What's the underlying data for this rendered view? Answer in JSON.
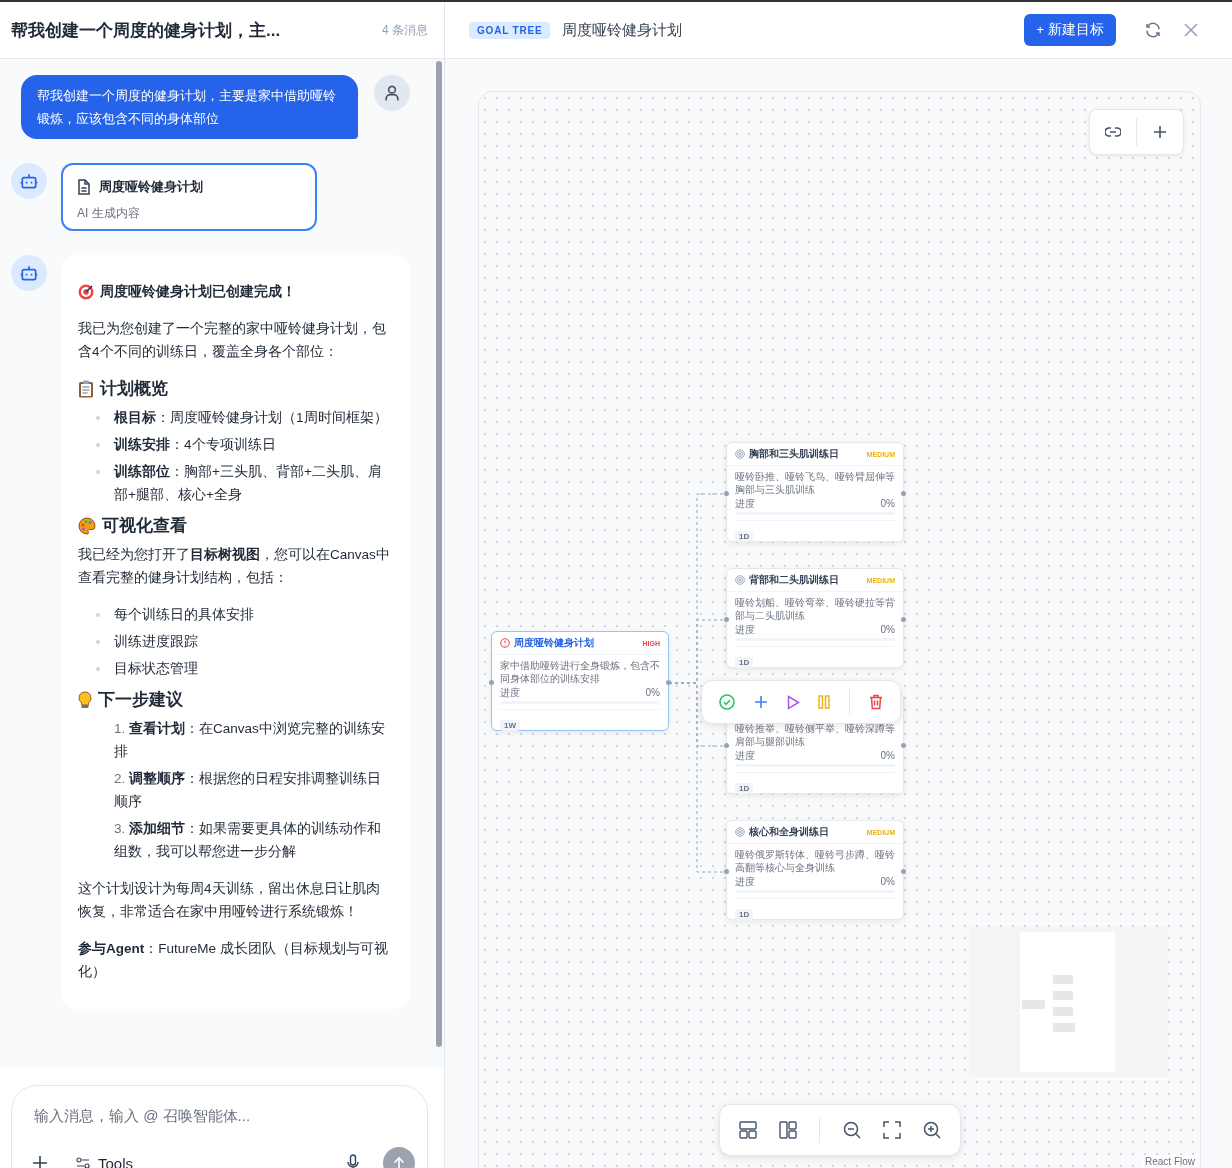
{
  "chat": {
    "title": "帮我创建一个周度的健身计划，主...",
    "count": "4 条消息",
    "user_message": "帮我创建一个周度的健身计划，主要是家中借助哑铃锻炼，应该包含不同的身体部位",
    "artifact": {
      "title": "周度哑铃健身计划",
      "subtitle": "AI 生成内容"
    },
    "reply": [
      {
        "kind": "title",
        "text": "周度哑铃健身计划已创建完成！"
      },
      {
        "kind": "paragraph",
        "text": "我已为您创建了一个完整的家中哑铃健身计划，包含4个不同的训练日，覆盖全身各个部位："
      },
      {
        "kind": "heading",
        "text": "计划概览"
      },
      {
        "kind": "bullets",
        "items": [
          "**根目标**：周度哑铃健身计划（1周时间框架）",
          "**训练安排**：4个专项训练日",
          "**训练部位**：胸部+三头肌、背部+二头肌、肩部+腿部、核心+全身"
        ]
      },
      {
        "kind": "heading",
        "text": "可视化查看"
      },
      {
        "kind": "paragraph",
        "text": "我已经为您打开了**目标树视图**，您可以在Canvas中查看完整的健身计划结构，包括："
      },
      {
        "kind": "bullets",
        "items": [
          "每个训练日的具体安排",
          "训练进度跟踪",
          "目标状态管理"
        ]
      },
      {
        "kind": "heading",
        "text": "下一步建议"
      },
      {
        "kind": "numbered",
        "items": [
          {
            "number": "1.",
            "text": "**查看计划**：在Canvas中浏览完整的训练安排"
          },
          {
            "number": "2.",
            "text": "**调整顺序**：根据您的日程安排调整训练日顺序"
          },
          {
            "number": "3.",
            "text": "**添加细节**：如果需要更具体的训练动作和组数，我可以帮您进一步分解"
          }
        ]
      },
      {
        "kind": "paragraph",
        "text": "这个计划设计为每周4天训练，留出休息日让肌肉恢复，非常适合在家中用哑铃进行系统锻炼！"
      },
      {
        "kind": "paragraph",
        "text": "**参与Agent**：FutureMe 成长团队（目标规划与可视化）"
      }
    ],
    "input": {
      "placeholder": "输入消息，输入 @ 召唤智能体...",
      "tools_label": "Tools",
      "send_disabled": true
    }
  },
  "canvas": {
    "badge": "GOAL TREE",
    "title": "周度哑铃健身计划",
    "new_button": "+ 新建目标",
    "root": {
      "title": "周度哑铃健身计划",
      "priority": "HIGH",
      "description": "家中借助哑铃进行全身锻炼，包含不同身体部位的训练安排",
      "progress_label": "进度",
      "progress": "0%",
      "level": 0,
      "duration": "1W",
      "selected": true,
      "children": [
        {
          "title": "胸部和三头肌训练日",
          "priority": "MEDIUM",
          "description": "哑铃卧推、哑铃飞鸟、哑铃臂屈伸等胸部与三头肌训练",
          "progress_label": "进度",
          "progress": "0%",
          "level": 0,
          "duration": "1D",
          "selected": false
        },
        {
          "title": "背部和二头肌训练日",
          "priority": "MEDIUM",
          "description": "哑铃划船、哑铃弯举、哑铃硬拉等背部与二头肌训练",
          "progress_label": "进度",
          "progress": "0%",
          "level": 0,
          "duration": "1D",
          "selected": false
        },
        {
          "description": "哑铃推举、哑铃侧平举、哑铃深蹲等肩部与腿部训练",
          "progress_label": "进度",
          "progress": "0%",
          "level": 0,
          "duration": "1D",
          "selected": false
        },
        {
          "title": "核心和全身训练日",
          "priority": "MEDIUM",
          "description": "哑铃俄罗斯转体、哑铃弓步蹲、哑铃高翻等核心与全身训练",
          "progress_label": "进度",
          "progress": "0%",
          "level": 0,
          "duration": "1D",
          "selected": false
        }
      ]
    },
    "attribution": "React Flow"
  }
}
